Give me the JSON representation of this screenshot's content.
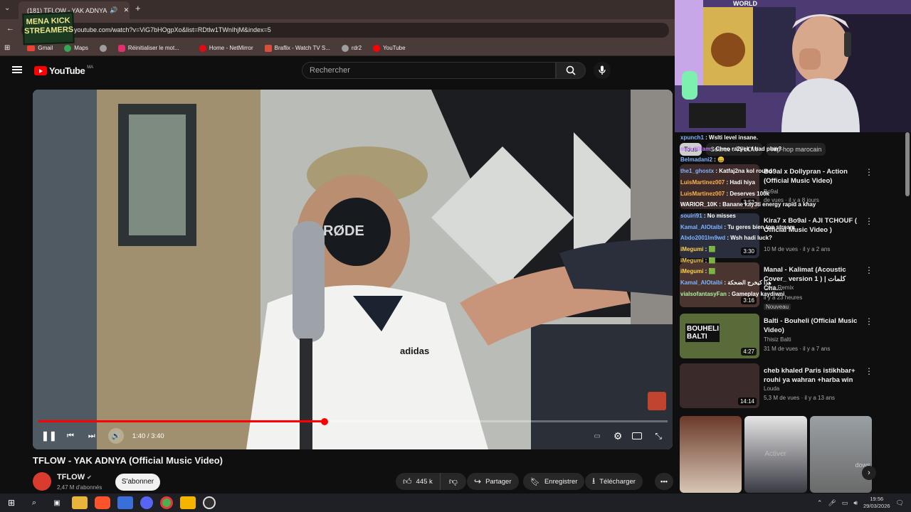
{
  "browser": {
    "tab_title": "(181) TFLOW - YAK ADNYA",
    "url": "youtube.com/watch?v=ViG7bHOgpXo&list=RDtlw1TWnIhjM&index=5",
    "bookmarks": [
      {
        "label": "Gmail",
        "color": "#ea4335"
      },
      {
        "label": "Maps",
        "color": "#34a853"
      },
      {
        "label": "",
        "color": "#9e9e9e"
      },
      {
        "label": "Réinitialiser le mot...",
        "color": "#e1306c"
      },
      {
        "label": "Home - NetMirror",
        "color": "#e50914"
      },
      {
        "label": "Braflix - Watch TV S...",
        "color": "#d94f3b"
      },
      {
        "label": "rdr2",
        "color": "#9e9e9e"
      },
      {
        "label": "YouTube",
        "color": "#ff0000"
      }
    ],
    "overlay_logo": "MENA KICK STREAMERS"
  },
  "youtube": {
    "brand": "YouTube",
    "region": "MA",
    "search_placeholder": "Rechercher"
  },
  "player": {
    "mic_brand": "RØDE",
    "shirt_brand": "adidas",
    "time": "1:40 / 3:40",
    "progress": 0.455
  },
  "video": {
    "title": "TFLOW - YAK ADNYA (Official Music Video)",
    "channel": "TFLOW",
    "subscribers": "2,47 M d'abonnés",
    "subscribe_label": "S'abonner",
    "likes": "445 k",
    "share_label": "Partager",
    "save_label": "Enregistrer",
    "download_label": "Télécharger"
  },
  "webcam": {
    "sign": "WORLD",
    "tab_tous": "Tous",
    "tab_source": "Source : TFLOW",
    "tab_hiphop": "Hip-hop marocain"
  },
  "chat": [
    {
      "user": "xpunch1",
      "msg": "Wslti level insane.",
      "color": "#7fb3ff"
    },
    {
      "user": "mahdi0fam",
      "msg": "Chno ra2yek f had plan?",
      "color": "#c77dff"
    },
    {
      "user": "Belmadani2",
      "msg": "😄",
      "color": "#7fb3ff"
    },
    {
      "user": "the1_ghostx",
      "msg": "Katfaj2na kol round",
      "color": "#7fb3ff"
    },
    {
      "user": "LuisMartinez007",
      "msg": "Hadi hiya",
      "color": "#ffb347"
    },
    {
      "user": "LuisMartinez007",
      "msg": "Deserves 100k",
      "color": "#ffb347"
    },
    {
      "user": "WARIOR_10K",
      "msg": "Banane kay3ti energy rapid a khay",
      "color": "#ffffff"
    },
    {
      "user": "souiri91",
      "msg": "No misses",
      "color": "#7fb3ff"
    },
    {
      "user": "Kamal_AlOtaibi",
      "msg": "Tu geres bien ton stream",
      "color": "#7fb3ff"
    },
    {
      "user": "Abdo2001lm9wd",
      "msg": "Wsh hadi luck?",
      "color": "#7fb3ff"
    },
    {
      "user": "iMegumi",
      "msg": "🟩",
      "color": "#ffd24d"
    },
    {
      "user": "iMegumi",
      "msg": "🟩",
      "color": "#ffd24d"
    },
    {
      "user": "iMegumi",
      "msg": "🟩",
      "color": "#ffd24d"
    },
    {
      "user": "Kamal_AlOtaibi",
      "msg": "هذا كيخرج الضحكة",
      "color": "#7fb3ff"
    },
    {
      "user": "vialsofantasyFan",
      "msg": "Gameplay kaydiwni",
      "color": "#aef0a0"
    }
  ],
  "recommended": [
    {
      "title": "Bo9al x Dollypran - Action (Official Music Video)",
      "channel": "Bo9al",
      "meta": "de vues · il y a 8 jours",
      "duration": "3:52",
      "thumb": "#3d2b2b"
    },
    {
      "title": "Kira7 x Bo9al - AJI TCHOUF ( Official Music Video )",
      "channel": "",
      "meta": "10 M de vues · il y a 2 ans",
      "duration": "3:30",
      "thumb": "#2b2f3d"
    },
    {
      "title": "Manal - Kalimat (Acoustic Cover_ version 1 ) | كلمات Cha...",
      "channel": "Cera Remix",
      "meta": "il y a 23 heures",
      "badge": "Nouveau",
      "duration": "3:16",
      "thumb": "#4a3530"
    },
    {
      "title": "Balti - Bouheli (Official Music Video)",
      "channel": "Thisiz Balti",
      "meta": "31 M de vues · il y a 7 ans",
      "duration": "4:27",
      "thumb": "#5a6b3a",
      "thumb_text": "BOUHELI BALTI"
    },
    {
      "title": "cheb khaled  Paris istikhbar+ rouhi ya wahran +harba win",
      "channel": "Louda",
      "meta": "5,3 M de vues · il y a 13 ans",
      "duration": "14:14",
      "thumb": "#3a2a2a"
    }
  ],
  "shorts_overlay": {
    "activate": "Activer",
    "windows": "dows"
  },
  "taskbar": {
    "time": "19:56",
    "date": "29/03/2026"
  }
}
